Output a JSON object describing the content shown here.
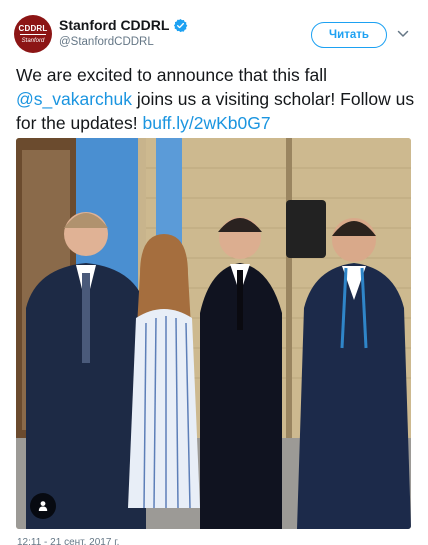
{
  "tweet": {
    "author": {
      "name": "Stanford CDDRL",
      "handle": "@StanfordCDDRL",
      "avatar_text_top": "CDDRL",
      "avatar_text_bottom": "Stanford",
      "avatar_color": "#8c1515"
    },
    "follow_label": "Читать",
    "text_before_mention": "We are excited to announce that this fall ",
    "mention": "@s_vakarchuk",
    "text_after_mention": " joins us a visiting scholar! Follow us for the updates! ",
    "link": "buff.ly/2wKb0G7",
    "media_badge_icon": "person-icon",
    "timestamp": "12:11 - 21 сент. 2017 г.",
    "colors": {
      "link": "#1b95e0",
      "accent": "#1da1f2",
      "text": "#14171a",
      "secondary": "#657786"
    }
  }
}
